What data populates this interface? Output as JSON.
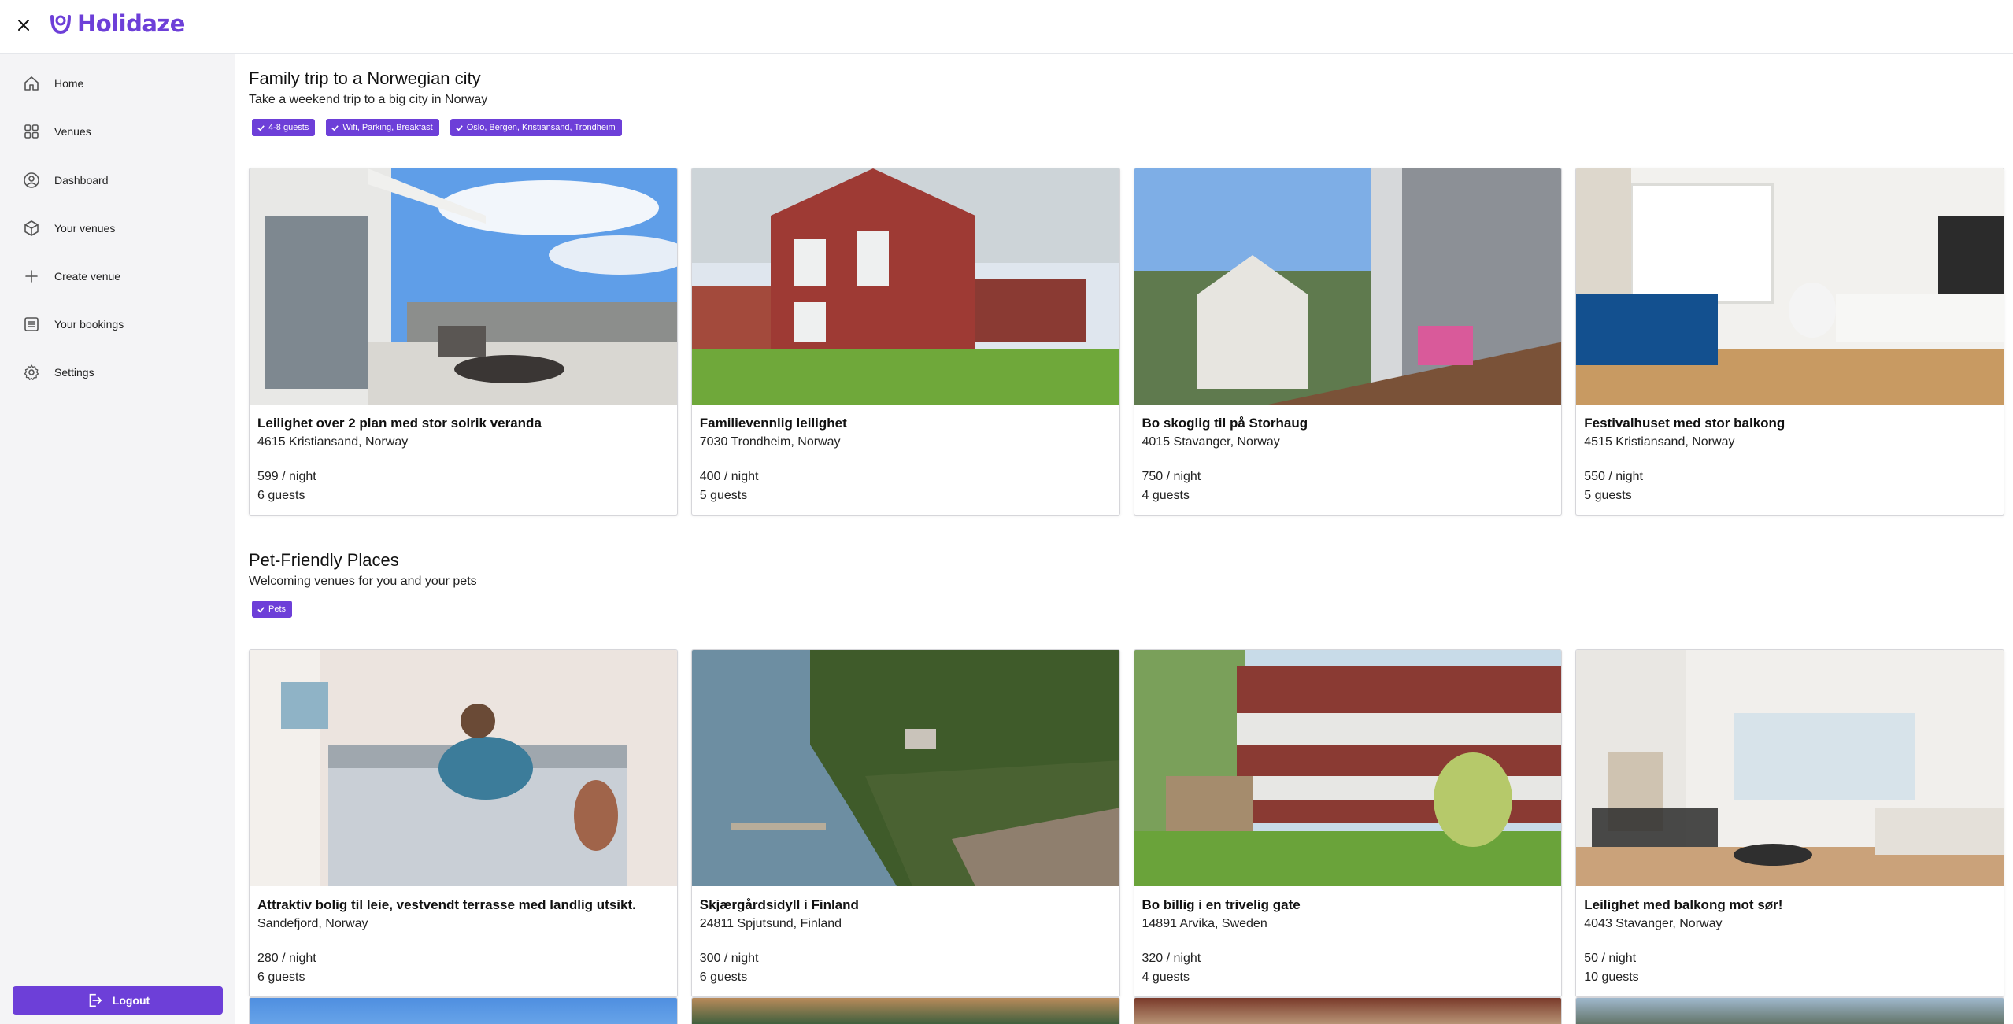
{
  "app": {
    "name": "Holidaze"
  },
  "sidebar": {
    "items": [
      {
        "label": "Home",
        "icon": "home-icon"
      },
      {
        "label": "Venues",
        "icon": "grid-icon"
      },
      {
        "label": "Dashboard",
        "icon": "user-circle-icon"
      },
      {
        "label": "Your venues",
        "icon": "cube-icon"
      },
      {
        "label": "Create venue",
        "icon": "plus-icon"
      },
      {
        "label": "Your bookings",
        "icon": "list-icon"
      },
      {
        "label": "Settings",
        "icon": "gear-icon"
      }
    ],
    "logout_label": "Logout"
  },
  "sections": [
    {
      "title": "Family trip to a Norwegian city",
      "subtitle": "Take a weekend trip to a big city in Norway",
      "tags": [
        "4-8 guests",
        "Wifi, Parking, Breakfast",
        "Oslo, Bergen, Kristiansand, Trondheim"
      ],
      "cards": [
        {
          "title": "Leilighet over 2 plan med stor solrik veranda",
          "location": "4615 Kristiansand, Norway",
          "price": "599 / night",
          "guests": "6 guests"
        },
        {
          "title": "Familievennlig leilighet",
          "location": "7030 Trondheim, Norway",
          "price": "400 / night",
          "guests": "5 guests"
        },
        {
          "title": "Bo skoglig til på Storhaug",
          "location": "4015 Stavanger, Norway",
          "price": "750 / night",
          "guests": "4 guests"
        },
        {
          "title": "Festivalhuset med stor balkong",
          "location": "4515 Kristiansand, Norway",
          "price": "550 / night",
          "guests": "5 guests"
        }
      ]
    },
    {
      "title": "Pet-Friendly Places",
      "subtitle": "Welcoming venues for you and your pets",
      "tags": [
        "Pets"
      ],
      "cards": [
        {
          "title": "Attraktiv bolig til leie, vestvendt terrasse med landlig utsikt.",
          "location": "Sandefjord, Norway",
          "price": "280 / night",
          "guests": "6 guests"
        },
        {
          "title": "Skjærgårdsidyll i Finland",
          "location": "24811 Spjutsund, Finland",
          "price": "300 / night",
          "guests": "6 guests"
        },
        {
          "title": "Bo billig i en trivelig gate",
          "location": "14891 Arvika, Sweden",
          "price": "320 / night",
          "guests": "4 guests"
        },
        {
          "title": "Leilighet med balkong mot sør!",
          "location": "4043 Stavanger, Norway",
          "price": "50 / night",
          "guests": "10 guests"
        }
      ]
    }
  ],
  "colors": {
    "accent": "#6d3fd8",
    "sidebar_bg": "#f4f4f6"
  }
}
